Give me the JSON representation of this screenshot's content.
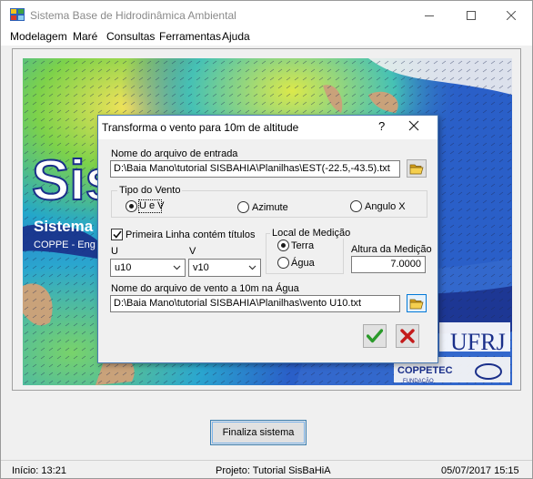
{
  "window": {
    "title": "Sistema Base de Hidrodinâmica Ambiental",
    "menu": [
      "Modelagem",
      "Maré",
      "Consultas",
      "Ferramentas",
      "Ajuda"
    ]
  },
  "splash": {
    "big_text": "Sis",
    "line1": "Sistema",
    "line2": "COPPE - Eng",
    "logo_ufrj": "UFRJ",
    "logo_coppetec": "COPPETEC",
    "logo_fundacao": "FUNDAÇÃO"
  },
  "dialog": {
    "title": "Transforma o vento para 10m de altitude",
    "help_glyph": "?",
    "input_file_label": "Nome do arquivo de entrada",
    "input_file_value": "D:\\Baia Mano\\tutorial SISBAHIA\\Planilhas\\EST(-22.5,-43.5).txt",
    "wind_type": {
      "title": "Tipo do Vento",
      "options": [
        "U e V",
        "Azimute",
        "Angulo X"
      ],
      "selected": "U e V"
    },
    "first_line_titles": {
      "label": "Primeira Linha contém títulos",
      "checked": true
    },
    "u_label": "U",
    "u_value": "u10",
    "v_label": "V",
    "v_value": "v10",
    "measurement_place": {
      "title": "Local de Medição",
      "options": [
        "Terra",
        "Água"
      ],
      "selected": "Terra"
    },
    "height_label": "Altura da Medição",
    "height_value": "7.0000",
    "output_file_label": "Nome do arquivo de vento a 10m na Água",
    "output_file_value": "D:\\Baia Mano\\tutorial SISBAHIA\\Planilhas\\vento U10.txt"
  },
  "finalize_button": "Finaliza sistema",
  "status": {
    "start": "Início: 13:21",
    "project": "Projeto: Tutorial SisBaHiA",
    "datetime": "05/07/2017 15:15"
  },
  "colors": {
    "ok_green": "#2a9a2a",
    "cancel_red": "#c41b1b",
    "dialog_border": "#4a7ab3",
    "splash_blue": "#1a2f8a"
  }
}
